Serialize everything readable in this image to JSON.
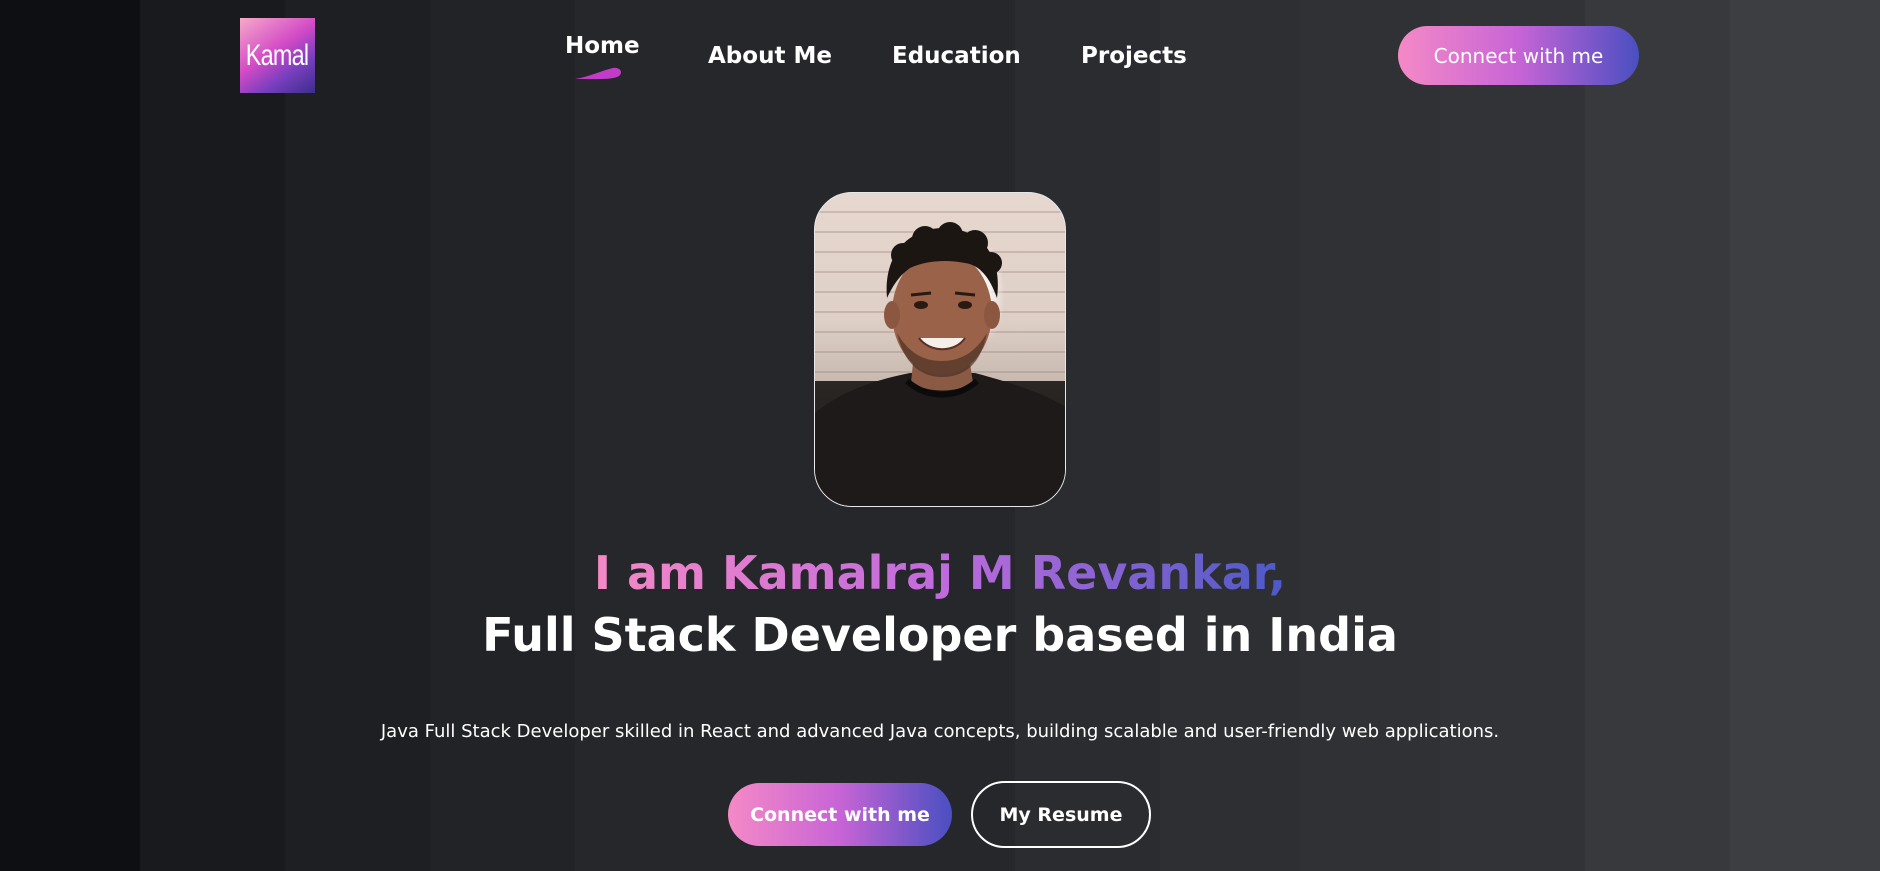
{
  "logo": {
    "text": "Kamal"
  },
  "nav": {
    "items": [
      {
        "label": "Home",
        "active": true
      },
      {
        "label": "About Me",
        "active": false
      },
      {
        "label": "Education",
        "active": false
      },
      {
        "label": "Projects",
        "active": false
      }
    ],
    "connect_label": "Connect with me"
  },
  "hero": {
    "greeting": "I am Kamalraj M Revankar,",
    "tagline": "Full Stack Developer based in India",
    "description": "Java Full Stack Developer skilled in React and advanced Java concepts, building scalable and user-friendly web applications.",
    "connect_label": "Connect with me",
    "resume_label": "My Resume"
  },
  "colors": {
    "gradient_start": "#f589c6",
    "gradient_mid": "#c764d6",
    "gradient_end": "#4a4fc1",
    "indicator": "#c13cc9"
  }
}
